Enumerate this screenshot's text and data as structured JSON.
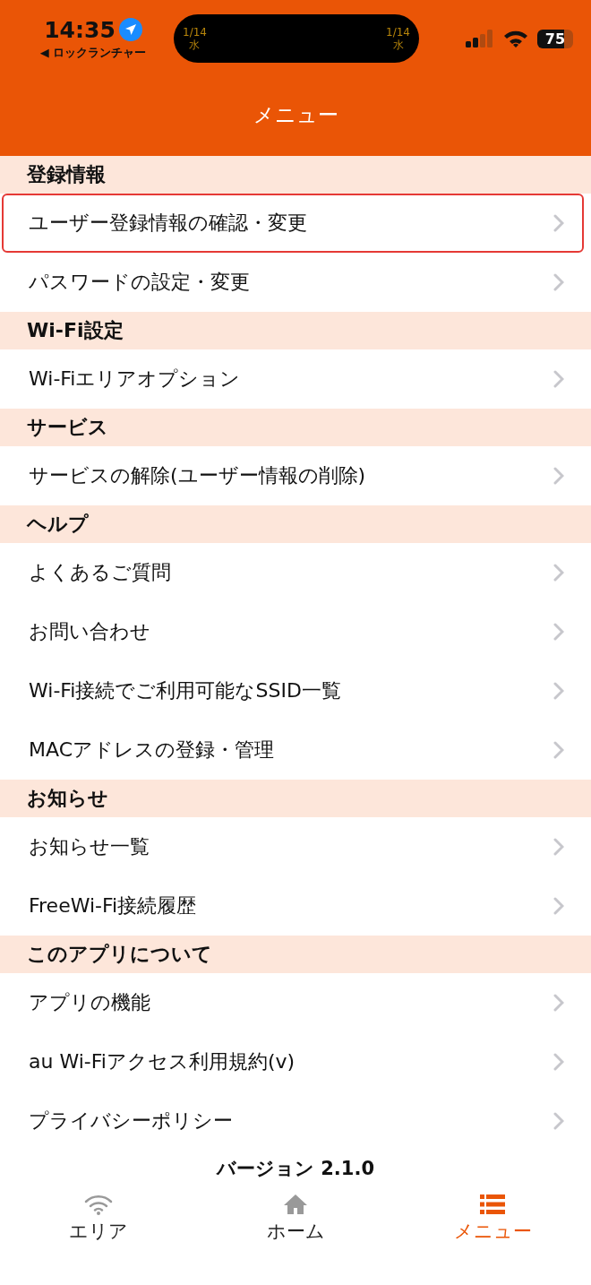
{
  "status_bar": {
    "time": "14:35",
    "back_app": "◀ ロックランチャー",
    "island_left": {
      "date": "1/14",
      "weekday": "水"
    },
    "island_right": {
      "date": "1/14",
      "weekday": "水"
    },
    "battery": "75"
  },
  "header": {
    "title": "メニュー"
  },
  "sections": [
    {
      "title": "登録情報",
      "items": [
        {
          "label": "ユーザー登録情報の確認・変更",
          "highlighted": true
        },
        {
          "label": "パスワードの設定・変更",
          "highlighted": false
        }
      ]
    },
    {
      "title": "Wi-Fi設定",
      "items": [
        {
          "label": "Wi-Fiエリアオプション",
          "highlighted": false
        }
      ]
    },
    {
      "title": "サービス",
      "items": [
        {
          "label": "サービスの解除(ユーザー情報の削除)",
          "highlighted": false
        }
      ]
    },
    {
      "title": "ヘルプ",
      "items": [
        {
          "label": "よくあるご質問",
          "highlighted": false
        },
        {
          "label": "お問い合わせ",
          "highlighted": false
        },
        {
          "label": "Wi-Fi接続でご利用可能なSSID一覧",
          "highlighted": false
        },
        {
          "label": "MACアドレスの登録・管理",
          "highlighted": false
        }
      ]
    },
    {
      "title": "お知らせ",
      "items": [
        {
          "label": "お知らせ一覧",
          "highlighted": false
        },
        {
          "label": "FreeWi-Fi接続履歴",
          "highlighted": false
        }
      ]
    },
    {
      "title": "このアプリについて",
      "items": [
        {
          "label": "アプリの機能",
          "highlighted": false
        },
        {
          "label": "au Wi-Fiアクセス利用規約(v)",
          "highlighted": false
        },
        {
          "label": "プライバシーポリシー",
          "highlighted": false
        }
      ]
    }
  ],
  "version": "バージョン 2.1.0",
  "tabs": [
    {
      "kind": "wifi",
      "label": "エリア",
      "selected": false
    },
    {
      "kind": "home",
      "label": "ホーム",
      "selected": false
    },
    {
      "kind": "menu",
      "label": "メニュー",
      "selected": true
    }
  ]
}
